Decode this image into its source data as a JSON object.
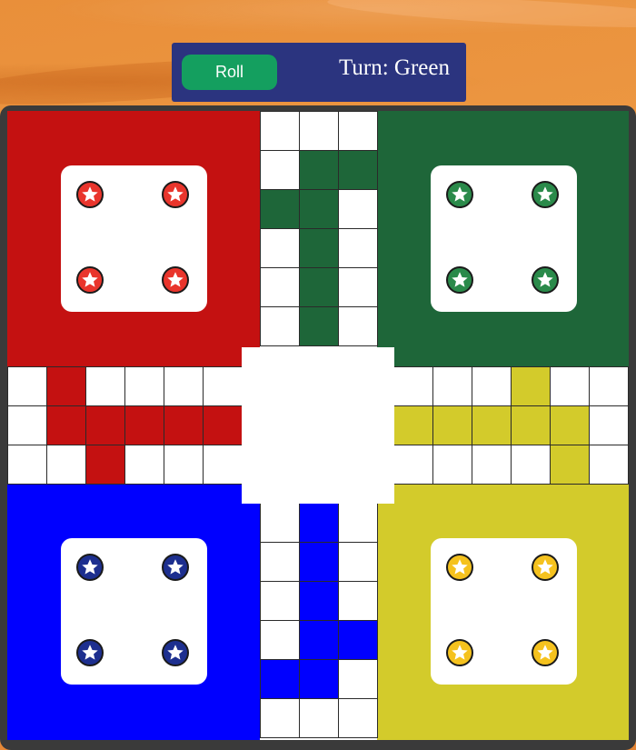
{
  "controls": {
    "roll_label": "Roll",
    "turn_text": "Turn: Green"
  },
  "colors": {
    "red": "#c41111",
    "green": "#1e6639",
    "blue": "#0000ff",
    "yellow": "#d3cb2b",
    "token_red": "#e9352c",
    "token_green": "#2a8a4a",
    "token_blue": "#1d2f8f",
    "token_yellow": "#f5c21e",
    "topbar": "#2b347f",
    "roll_button": "#149f5f"
  },
  "homes": [
    {
      "player": "red",
      "tokens": 4,
      "token_icon": "star-icon"
    },
    {
      "player": "green",
      "tokens": 4,
      "token_icon": "star-icon"
    },
    {
      "player": "blue",
      "tokens": 4,
      "token_icon": "star-icon"
    },
    {
      "player": "yellow",
      "tokens": 4,
      "token_icon": "star-icon"
    }
  ],
  "tracks": {
    "top_colored": [
      [
        1,
        1
      ],
      [
        1,
        2
      ],
      [
        2,
        0
      ],
      [
        2,
        1
      ],
      [
        3,
        1
      ],
      [
        4,
        1
      ],
      [
        5,
        1
      ]
    ],
    "left_colored": [
      [
        0,
        1
      ],
      [
        1,
        1
      ],
      [
        1,
        2
      ],
      [
        1,
        3
      ],
      [
        1,
        4
      ],
      [
        1,
        5
      ],
      [
        2,
        2
      ]
    ],
    "right_colored": [
      [
        0,
        3
      ],
      [
        1,
        0
      ],
      [
        1,
        1
      ],
      [
        1,
        2
      ],
      [
        1,
        3
      ],
      [
        1,
        4
      ],
      [
        2,
        4
      ]
    ],
    "bottom_colored": [
      [
        0,
        1
      ],
      [
        1,
        1
      ],
      [
        2,
        1
      ],
      [
        3,
        1
      ],
      [
        3,
        2
      ],
      [
        4,
        0
      ],
      [
        4,
        1
      ]
    ]
  }
}
